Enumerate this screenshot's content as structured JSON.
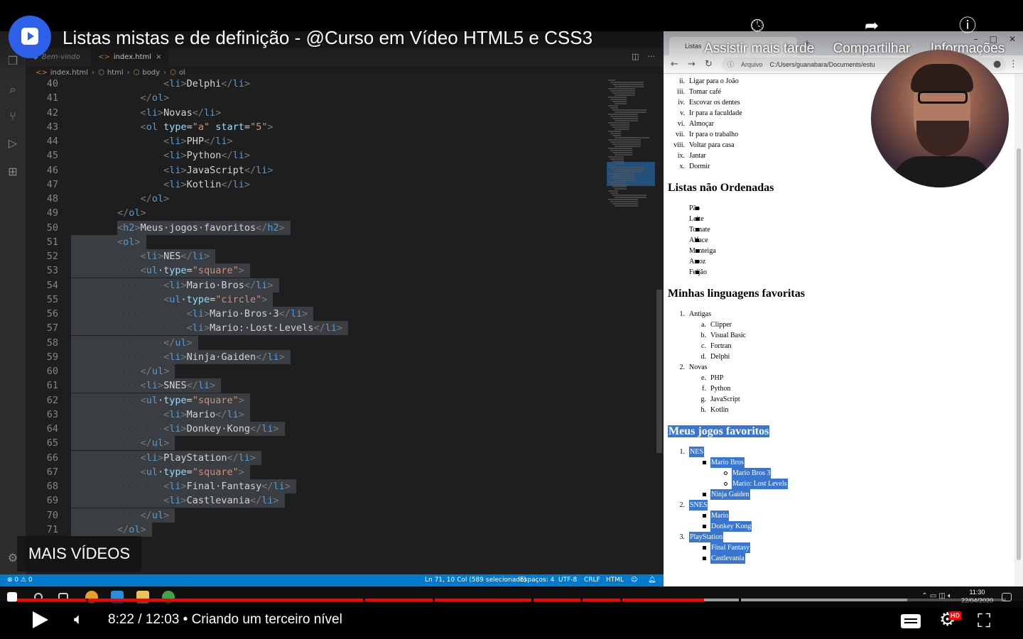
{
  "video": {
    "title": "Listas mistas e de definição - @Curso em Vídeo HTML5 e CSS3",
    "watch_later": "Assistir mais tarde",
    "share": "Compartilhar",
    "info": "Informações",
    "more_videos": "MAIS VÍDEOS",
    "time": "8:22 / 12:03 • Criando um terceiro nível",
    "hd_badge": "HD",
    "progress_played": 0.695,
    "progress_buffered": 0.9,
    "colors": {
      "progress": "#ff0000",
      "logo": "#2f60e8"
    }
  },
  "vscode": {
    "tabs": [
      {
        "label": "Bem-vindo",
        "active": false
      },
      {
        "label": "index.html",
        "active": true,
        "close": "×"
      }
    ],
    "breadcrumb": [
      "index.html",
      "html",
      "body",
      "ol"
    ],
    "status": {
      "problems": "⊗ 0 ⚠ 0",
      "cursor": "Ln 71, 10 Col (589 selecionado)",
      "spaces": "Espaços: 4",
      "encoding": "UTF-8",
      "eol": "CRLF",
      "language": "HTML"
    },
    "colors": {
      "statusbar": "#007acc",
      "tag": "#569cd6",
      "attr": "#9cdcfe",
      "string": "#ce9178"
    },
    "lines": [
      {
        "n": "40",
        "i": 2,
        "c": [
          [
            "b",
            "<"
          ],
          [
            "g",
            "li"
          ],
          [
            "b",
            ">"
          ],
          [
            "x",
            "Delphi"
          ],
          [
            "b",
            "</"
          ],
          [
            "g",
            "li"
          ],
          [
            "b",
            ">"
          ]
        ]
      },
      {
        "n": "41",
        "i": 1,
        "c": [
          [
            "b",
            "</"
          ],
          [
            "g",
            "ol"
          ],
          [
            "b",
            ">"
          ]
        ]
      },
      {
        "n": "42",
        "i": 1,
        "c": [
          [
            "b",
            "<"
          ],
          [
            "g",
            "li"
          ],
          [
            "b",
            ">"
          ],
          [
            "x",
            "Novas"
          ],
          [
            "b",
            "</"
          ],
          [
            "g",
            "li"
          ],
          [
            "b",
            ">"
          ]
        ]
      },
      {
        "n": "43",
        "i": 1,
        "c": [
          [
            "b",
            "<"
          ],
          [
            "g",
            "ol"
          ],
          [
            "x",
            " "
          ],
          [
            "a",
            "type"
          ],
          [
            "e",
            "="
          ],
          [
            "s",
            "\"a\""
          ],
          [
            "x",
            " "
          ],
          [
            "a",
            "start"
          ],
          [
            "e",
            "="
          ],
          [
            "s",
            "\"5\""
          ],
          [
            "b",
            ">"
          ]
        ]
      },
      {
        "n": "44",
        "i": 2,
        "c": [
          [
            "b",
            "<"
          ],
          [
            "g",
            "li"
          ],
          [
            "b",
            ">"
          ],
          [
            "x",
            "PHP"
          ],
          [
            "b",
            "</"
          ],
          [
            "g",
            "li"
          ],
          [
            "b",
            ">"
          ]
        ]
      },
      {
        "n": "45",
        "i": 2,
        "c": [
          [
            "b",
            "<"
          ],
          [
            "g",
            "li"
          ],
          [
            "b",
            ">"
          ],
          [
            "x",
            "Python"
          ],
          [
            "b",
            "</"
          ],
          [
            "g",
            "li"
          ],
          [
            "b",
            ">"
          ]
        ]
      },
      {
        "n": "46",
        "i": 2,
        "c": [
          [
            "b",
            "<"
          ],
          [
            "g",
            "li"
          ],
          [
            "b",
            ">"
          ],
          [
            "x",
            "JavaScript"
          ],
          [
            "b",
            "</"
          ],
          [
            "g",
            "li"
          ],
          [
            "b",
            ">"
          ]
        ]
      },
      {
        "n": "47",
        "i": 2,
        "c": [
          [
            "b",
            "<"
          ],
          [
            "g",
            "li"
          ],
          [
            "b",
            ">"
          ],
          [
            "x",
            "Kotlin"
          ],
          [
            "b",
            "</"
          ],
          [
            "g",
            "li"
          ],
          [
            "b",
            ">"
          ]
        ]
      },
      {
        "n": "48",
        "i": 1,
        "c": [
          [
            "b",
            "</"
          ],
          [
            "g",
            "ol"
          ],
          [
            "b",
            ">"
          ]
        ]
      },
      {
        "n": "49",
        "i": 0,
        "c": [
          [
            "b",
            "</"
          ],
          [
            "g",
            "ol"
          ],
          [
            "b",
            ">"
          ]
        ]
      },
      {
        "n": "50",
        "i": 0,
        "sel": true,
        "c": [
          [
            "b",
            "<"
          ],
          [
            "g",
            "h2"
          ],
          [
            "b",
            ">"
          ],
          [
            "x",
            "Meus jogos favoritos"
          ],
          [
            "b",
            "</"
          ],
          [
            "g",
            "h2"
          ],
          [
            "b",
            ">"
          ]
        ]
      },
      {
        "n": "51",
        "i": 0,
        "sel": true,
        "c": [
          [
            "b",
            "<"
          ],
          [
            "g",
            "ol"
          ],
          [
            "b",
            ">"
          ]
        ]
      },
      {
        "n": "52",
        "i": 1,
        "sel": true,
        "c": [
          [
            "b",
            "<"
          ],
          [
            "g",
            "li"
          ],
          [
            "b",
            ">"
          ],
          [
            "x",
            "NES"
          ],
          [
            "b",
            "</"
          ],
          [
            "g",
            "li"
          ],
          [
            "b",
            ">"
          ]
        ]
      },
      {
        "n": "53",
        "i": 1,
        "sel": true,
        "c": [
          [
            "b",
            "<"
          ],
          [
            "g",
            "ul"
          ],
          [
            "x",
            " "
          ],
          [
            "a",
            "type"
          ],
          [
            "e",
            "="
          ],
          [
            "s",
            "\"square\""
          ],
          [
            "b",
            ">"
          ]
        ]
      },
      {
        "n": "54",
        "i": 2,
        "sel": true,
        "c": [
          [
            "b",
            "<"
          ],
          [
            "g",
            "li"
          ],
          [
            "b",
            ">"
          ],
          [
            "x",
            "Mario Bros"
          ],
          [
            "b",
            "</"
          ],
          [
            "g",
            "li"
          ],
          [
            "b",
            ">"
          ]
        ]
      },
      {
        "n": "55",
        "i": 2,
        "sel": true,
        "c": [
          [
            "b",
            "<"
          ],
          [
            "g",
            "ul"
          ],
          [
            "x",
            " "
          ],
          [
            "a",
            "type"
          ],
          [
            "e",
            "="
          ],
          [
            "s",
            "\"circle\""
          ],
          [
            "b",
            ">"
          ]
        ]
      },
      {
        "n": "56",
        "i": 3,
        "sel": true,
        "c": [
          [
            "b",
            "<"
          ],
          [
            "g",
            "li"
          ],
          [
            "b",
            ">"
          ],
          [
            "x",
            "Mario Bros 3"
          ],
          [
            "b",
            "</"
          ],
          [
            "g",
            "li"
          ],
          [
            "b",
            ">"
          ]
        ]
      },
      {
        "n": "57",
        "i": 3,
        "sel": true,
        "c": [
          [
            "b",
            "<"
          ],
          [
            "g",
            "li"
          ],
          [
            "b",
            ">"
          ],
          [
            "x",
            "Mario: Lost Levels"
          ],
          [
            "b",
            "</"
          ],
          [
            "g",
            "li"
          ],
          [
            "b",
            ">"
          ]
        ]
      },
      {
        "n": "58",
        "i": 2,
        "sel": true,
        "c": [
          [
            "b",
            "</"
          ],
          [
            "g",
            "ul"
          ],
          [
            "b",
            ">"
          ]
        ]
      },
      {
        "n": "59",
        "i": 2,
        "sel": true,
        "c": [
          [
            "b",
            "<"
          ],
          [
            "g",
            "li"
          ],
          [
            "b",
            ">"
          ],
          [
            "x",
            "Ninja Gaiden"
          ],
          [
            "b",
            "</"
          ],
          [
            "g",
            "li"
          ],
          [
            "b",
            ">"
          ]
        ]
      },
      {
        "n": "60",
        "i": 1,
        "sel": true,
        "c": [
          [
            "b",
            "</"
          ],
          [
            "g",
            "ul"
          ],
          [
            "b",
            ">"
          ]
        ]
      },
      {
        "n": "61",
        "i": 1,
        "sel": true,
        "c": [
          [
            "b",
            "<"
          ],
          [
            "g",
            "li"
          ],
          [
            "b",
            ">"
          ],
          [
            "x",
            "SNES"
          ],
          [
            "b",
            "</"
          ],
          [
            "g",
            "li"
          ],
          [
            "b",
            ">"
          ]
        ]
      },
      {
        "n": "62",
        "i": 1,
        "sel": true,
        "c": [
          [
            "b",
            "<"
          ],
          [
            "g",
            "ul"
          ],
          [
            "x",
            " "
          ],
          [
            "a",
            "type"
          ],
          [
            "e",
            "="
          ],
          [
            "s",
            "\"square\""
          ],
          [
            "b",
            ">"
          ]
        ]
      },
      {
        "n": "63",
        "i": 2,
        "sel": true,
        "c": [
          [
            "b",
            "<"
          ],
          [
            "g",
            "li"
          ],
          [
            "b",
            ">"
          ],
          [
            "x",
            "Mario"
          ],
          [
            "b",
            "</"
          ],
          [
            "g",
            "li"
          ],
          [
            "b",
            ">"
          ]
        ]
      },
      {
        "n": "64",
        "i": 2,
        "sel": true,
        "c": [
          [
            "b",
            "<"
          ],
          [
            "g",
            "li"
          ],
          [
            "b",
            ">"
          ],
          [
            "x",
            "Donkey Kong"
          ],
          [
            "b",
            "</"
          ],
          [
            "g",
            "li"
          ],
          [
            "b",
            ">"
          ]
        ]
      },
      {
        "n": "65",
        "i": 1,
        "sel": true,
        "c": [
          [
            "b",
            "</"
          ],
          [
            "g",
            "ul"
          ],
          [
            "b",
            ">"
          ]
        ]
      },
      {
        "n": "66",
        "i": 1,
        "sel": true,
        "c": [
          [
            "b",
            "<"
          ],
          [
            "g",
            "li"
          ],
          [
            "b",
            ">"
          ],
          [
            "x",
            "PlayStation"
          ],
          [
            "b",
            "</"
          ],
          [
            "g",
            "li"
          ],
          [
            "b",
            ">"
          ]
        ]
      },
      {
        "n": "67",
        "i": 1,
        "sel": true,
        "c": [
          [
            "b",
            "<"
          ],
          [
            "g",
            "ul"
          ],
          [
            "x",
            " "
          ],
          [
            "a",
            "type"
          ],
          [
            "e",
            "="
          ],
          [
            "s",
            "\"square\""
          ],
          [
            "b",
            ">"
          ]
        ]
      },
      {
        "n": "68",
        "i": 2,
        "sel": true,
        "c": [
          [
            "b",
            "<"
          ],
          [
            "g",
            "li"
          ],
          [
            "b",
            ">"
          ],
          [
            "x",
            "Final Fantasy"
          ],
          [
            "b",
            "</"
          ],
          [
            "g",
            "li"
          ],
          [
            "b",
            ">"
          ]
        ]
      },
      {
        "n": "69",
        "i": 2,
        "sel": true,
        "c": [
          [
            "b",
            "<"
          ],
          [
            "g",
            "li"
          ],
          [
            "b",
            ">"
          ],
          [
            "x",
            "Castlevania"
          ],
          [
            "b",
            "</"
          ],
          [
            "g",
            "li"
          ],
          [
            "b",
            ">"
          ]
        ]
      },
      {
        "n": "70",
        "i": 1,
        "sel": true,
        "c": [
          [
            "b",
            "</"
          ],
          [
            "g",
            "ul"
          ],
          [
            "b",
            ">"
          ]
        ]
      },
      {
        "n": "71",
        "i": 0,
        "sel": true,
        "c": [
          [
            "b",
            "</"
          ],
          [
            "g",
            "ol"
          ],
          [
            "b",
            ">"
          ]
        ]
      }
    ]
  },
  "browser": {
    "tab_title": "Listas",
    "tab_close": "×",
    "new_tab": "+",
    "address_chip": "Arquivo",
    "address": "C:/Users/guanabara/Documents/estu",
    "sections": [
      {
        "type": "items",
        "style": "roman",
        "items": [
          {
            "m": "ii.",
            "t": "Ligar para o João"
          },
          {
            "m": "iii.",
            "t": "Tomar café"
          },
          {
            "m": "iv.",
            "t": "Escovar os dentes"
          },
          {
            "m": "v.",
            "t": "Ir para a faculdade"
          },
          {
            "m": "vi.",
            "t": "Almoçar"
          },
          {
            "m": "vii.",
            "t": "Ir para o trabalho"
          },
          {
            "m": "viii.",
            "t": "Voltar para casa"
          },
          {
            "m": "ix.",
            "t": "Jantar"
          },
          {
            "m": "x.",
            "t": "Dormir"
          }
        ]
      },
      {
        "type": "heading",
        "t": "Listas não Ordenadas"
      },
      {
        "type": "items",
        "style": "square",
        "items": [
          {
            "t": "Pão"
          },
          {
            "t": "Leite"
          },
          {
            "t": "Tomate"
          },
          {
            "t": "Alface"
          },
          {
            "t": "Manteiga"
          },
          {
            "t": "Arroz"
          },
          {
            "t": "Feijão"
          }
        ]
      },
      {
        "type": "heading",
        "t": "Minhas linguagens favoritas"
      },
      {
        "type": "items",
        "style": "nested",
        "items": [
          {
            "m": "1.",
            "t": "Antigas",
            "lvl": 0
          },
          {
            "m": "a.",
            "t": "Clipper",
            "lvl": 1
          },
          {
            "m": "b.",
            "t": "Visual Basic",
            "lvl": 1
          },
          {
            "m": "c.",
            "t": "Fortran",
            "lvl": 1
          },
          {
            "m": "d.",
            "t": "Delphi",
            "lvl": 1
          },
          {
            "m": "2.",
            "t": "Novas",
            "lvl": 0
          },
          {
            "m": "e.",
            "t": "PHP",
            "lvl": 1
          },
          {
            "m": "f.",
            "t": "Python",
            "lvl": 1
          },
          {
            "m": "g.",
            "t": "JavaScript",
            "lvl": 1
          },
          {
            "m": "h.",
            "t": "Kotlin",
            "lvl": 1
          }
        ]
      },
      {
        "type": "heading",
        "t": "Meus jogos favoritos",
        "hl": true
      },
      {
        "type": "items",
        "style": "nested",
        "hl": true,
        "items": [
          {
            "m": "1.",
            "t": "NES",
            "lvl": 0
          },
          {
            "m": "sq",
            "t": "Mario Bros",
            "lvl": 1
          },
          {
            "m": "ci",
            "t": "Mario Bros 3",
            "lvl": 2
          },
          {
            "m": "ci",
            "t": "Mario: Lost Levels",
            "lvl": 2
          },
          {
            "m": "sq",
            "t": "Ninja Gaiden",
            "lvl": 1
          },
          {
            "m": "2.",
            "t": "SNES",
            "lvl": 0
          },
          {
            "m": "sq",
            "t": "Mario",
            "lvl": 1
          },
          {
            "m": "sq",
            "t": "Donkey Kong",
            "lvl": 1
          },
          {
            "m": "3.",
            "t": "PlayStation",
            "lvl": 0
          },
          {
            "m": "sq",
            "t": "Final Fantasy",
            "lvl": 1
          },
          {
            "m": "sq",
            "t": "Castlevania",
            "lvl": 1
          }
        ]
      }
    ]
  },
  "taskbar": {
    "time": "11:30",
    "date": "22/04/2020"
  }
}
